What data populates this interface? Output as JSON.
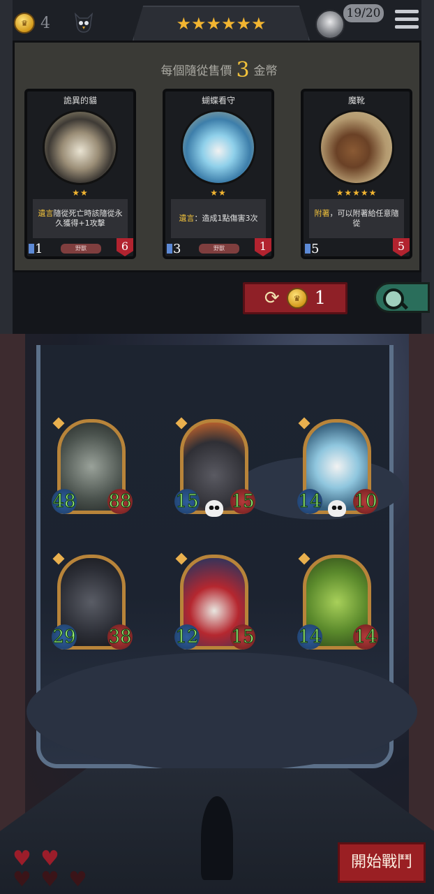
{
  "topbar": {
    "gold": "4",
    "tier_stars": "★★★★★★",
    "player_count": "19/20"
  },
  "shop": {
    "sell_prefix": "每個隨從售價",
    "sell_price": "3",
    "sell_suffix": "金幣",
    "cards": [
      {
        "name": "詭異的貓",
        "stars": "★★",
        "keyword": "遺言",
        "text": "隨從死亡時該隨從永久獲得+1攻擊",
        "tribe": "野獸",
        "attack": "1",
        "health": "6"
      },
      {
        "name": "蝴蝶看守",
        "stars": "★★",
        "keyword": "遺言",
        "text": "：造成1點傷害3次",
        "tribe": "野獸",
        "attack": "3",
        "health": "1"
      },
      {
        "name": "魔靴",
        "stars": "★★★★★",
        "keyword": "附著",
        "text": "，可以附著給任意隨從",
        "tribe": "",
        "attack": "5",
        "health": "5"
      }
    ],
    "refresh_cost": "1"
  },
  "board": {
    "minions": [
      {
        "attack": "48",
        "health": "88",
        "skull": false
      },
      {
        "attack": "15",
        "health": "15",
        "skull": true
      },
      {
        "attack": "14",
        "health": "10",
        "skull": true
      },
      {
        "attack": "29",
        "health": "38",
        "skull": false
      },
      {
        "attack": "12",
        "health": "15",
        "skull": false
      },
      {
        "attack": "14",
        "health": "14",
        "skull": false
      }
    ]
  },
  "bottom": {
    "start_battle": "開始戰鬥"
  },
  "colors": {
    "gold_star": "#f2b531",
    "refresh_red": "#8f2027",
    "start_red": "#9a1f23",
    "stat_green": "#9ef57c"
  }
}
